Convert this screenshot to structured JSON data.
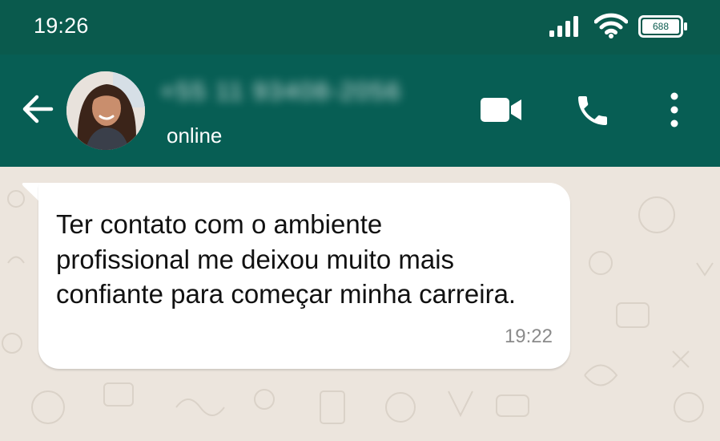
{
  "status_bar": {
    "time": "19:26",
    "battery_level": "688",
    "icons": [
      "signal-icon",
      "wifi-icon",
      "battery-icon"
    ]
  },
  "header": {
    "contact_name": "+55 11 93408-2056",
    "contact_status": "online",
    "icons": [
      "back-arrow-icon",
      "video-call-icon",
      "phone-icon",
      "more-options-icon"
    ]
  },
  "colors": {
    "header_bg": "#075e54",
    "status_bar_bg": "#0a5a4d",
    "chat_bg": "#ece5dd",
    "bubble_bg": "#ffffff"
  },
  "chat": {
    "messages": [
      {
        "lines": [
          "Ter contato com o ambiente",
          "profissional me deixou muito mais",
          "confiante para começar minha carreira."
        ],
        "time": "19:22",
        "direction": "incoming"
      }
    ]
  }
}
